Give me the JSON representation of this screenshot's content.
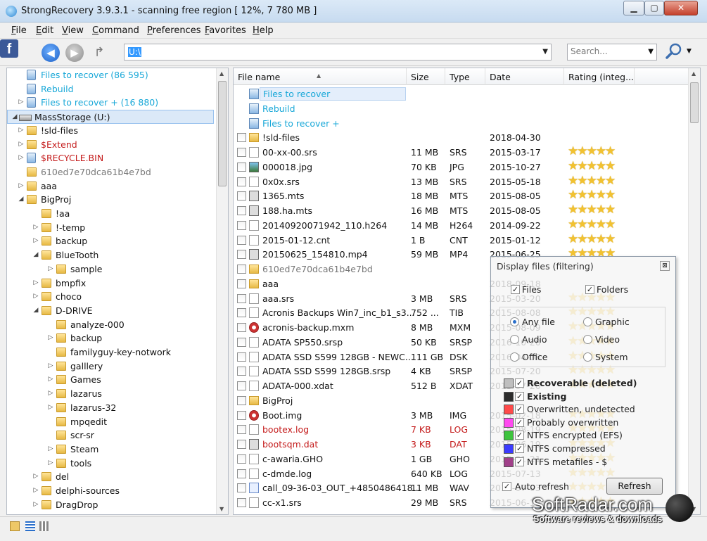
{
  "window": {
    "title": "StrongRecovery 3.9.3.1 - scanning free region [ 12%, 7 780 MB ]",
    "min": "▁",
    "max": "▢",
    "close": "✕"
  },
  "menu": [
    "File",
    "Edit",
    "View",
    "Command",
    "Preferences",
    "Favorites",
    "Help"
  ],
  "toolbar": {
    "fb": "f",
    "back": "◀",
    "forward": "▶",
    "up": "↱",
    "path": "U:\\",
    "search_placeholder": "Search...",
    "search_icon": "magnifier-icon"
  },
  "tree": [
    {
      "label": "Files to recover (86 595)",
      "level": 1,
      "icon": "bin",
      "arrow": "",
      "tone": "rec"
    },
    {
      "label": "Rebuild",
      "level": 1,
      "icon": "bin",
      "arrow": "",
      "tone": "rec"
    },
    {
      "label": "Files to recover + (16 880)",
      "level": 1,
      "icon": "bin",
      "arrow": "▷",
      "tone": "rec"
    },
    {
      "label": "MassStorage (U:)",
      "level": 0,
      "icon": "drive",
      "arrow": "◢",
      "tone": "",
      "selected": true
    },
    {
      "label": "!sld-files",
      "level": 1,
      "icon": "folder",
      "arrow": "▷",
      "tone": ""
    },
    {
      "label": "$Extend",
      "level": 1,
      "icon": "folder",
      "arrow": "▷",
      "tone": "del"
    },
    {
      "label": "$RECYCLE.BIN",
      "level": 1,
      "icon": "bin",
      "arrow": "▷",
      "tone": "del"
    },
    {
      "label": "610ed7e70dca61b4e7bd",
      "level": 1,
      "icon": "folder",
      "arrow": "",
      "tone": "gray"
    },
    {
      "label": "aaa",
      "level": 1,
      "icon": "folder",
      "arrow": "▷",
      "tone": ""
    },
    {
      "label": "BigProj",
      "level": 1,
      "icon": "folder",
      "arrow": "◢",
      "tone": ""
    },
    {
      "label": "!aa",
      "level": 2,
      "icon": "folder",
      "arrow": "",
      "tone": ""
    },
    {
      "label": "!-temp",
      "level": 2,
      "icon": "folder",
      "arrow": "▷",
      "tone": ""
    },
    {
      "label": "backup",
      "level": 2,
      "icon": "folder",
      "arrow": "▷",
      "tone": ""
    },
    {
      "label": "BlueTooth",
      "level": 2,
      "icon": "folder",
      "arrow": "◢",
      "tone": ""
    },
    {
      "label": "sample",
      "level": 3,
      "icon": "folder",
      "arrow": "▷",
      "tone": ""
    },
    {
      "label": "bmpfix",
      "level": 2,
      "icon": "folder",
      "arrow": "▷",
      "tone": ""
    },
    {
      "label": "choco",
      "level": 2,
      "icon": "folder",
      "arrow": "▷",
      "tone": ""
    },
    {
      "label": "D-DRIVE",
      "level": 2,
      "icon": "folder",
      "arrow": "◢",
      "tone": ""
    },
    {
      "label": "analyze-000",
      "level": 3,
      "icon": "folder",
      "arrow": "",
      "tone": ""
    },
    {
      "label": "backup",
      "level": 3,
      "icon": "folder",
      "arrow": "▷",
      "tone": ""
    },
    {
      "label": "familyguy-key-notwork",
      "level": 3,
      "icon": "folder",
      "arrow": "",
      "tone": ""
    },
    {
      "label": "galllery",
      "level": 3,
      "icon": "folder",
      "arrow": "▷",
      "tone": ""
    },
    {
      "label": "Games",
      "level": 3,
      "icon": "folder",
      "arrow": "▷",
      "tone": ""
    },
    {
      "label": "lazarus",
      "level": 3,
      "icon": "folder",
      "arrow": "▷",
      "tone": ""
    },
    {
      "label": "lazarus-32",
      "level": 3,
      "icon": "folder",
      "arrow": "▷",
      "tone": ""
    },
    {
      "label": "mpqedit",
      "level": 3,
      "icon": "folder",
      "arrow": "",
      "tone": ""
    },
    {
      "label": "scr-sr",
      "level": 3,
      "icon": "folder",
      "arrow": "",
      "tone": ""
    },
    {
      "label": "Steam",
      "level": 3,
      "icon": "folder",
      "arrow": "▷",
      "tone": ""
    },
    {
      "label": "tools",
      "level": 3,
      "icon": "folder",
      "arrow": "▷",
      "tone": ""
    },
    {
      "label": "del",
      "level": 2,
      "icon": "folder",
      "arrow": "▷",
      "tone": ""
    },
    {
      "label": "delphi-sources",
      "level": 2,
      "icon": "folder",
      "arrow": "▷",
      "tone": ""
    },
    {
      "label": "DragDrop",
      "level": 2,
      "icon": "folder",
      "arrow": "▷",
      "tone": ""
    }
  ],
  "columns": [
    "File name",
    "Size",
    "Type",
    "Date",
    "Rating (integ..."
  ],
  "files": [
    {
      "name": "Files to recover",
      "size": "",
      "type": "",
      "date": "",
      "icon": "bin",
      "tone": "rec",
      "cb": false,
      "stars": false,
      "hl": true
    },
    {
      "name": "Rebuild",
      "size": "",
      "type": "",
      "date": "",
      "icon": "bin",
      "tone": "rec",
      "cb": false,
      "stars": false
    },
    {
      "name": "Files to recover +",
      "size": "",
      "type": "",
      "date": "",
      "icon": "bin",
      "tone": "rec",
      "cb": false,
      "stars": false
    },
    {
      "name": "!sld-files",
      "size": "",
      "type": "",
      "date": "2018-04-30",
      "icon": "folder",
      "tone": "",
      "cb": true,
      "stars": false
    },
    {
      "name": "00-xx-00.srs",
      "size": "11 MB",
      "type": "SRS",
      "date": "2015-03-17",
      "icon": "doc",
      "tone": "",
      "cb": true,
      "stars": true
    },
    {
      "name": "000018.jpg",
      "size": "70 KB",
      "type": "JPG",
      "date": "2015-10-27",
      "icon": "img",
      "tone": "",
      "cb": true,
      "stars": true
    },
    {
      "name": "0x0x.srs",
      "size": "13 MB",
      "type": "SRS",
      "date": "2015-05-18",
      "icon": "doc",
      "tone": "",
      "cb": true,
      "stars": true
    },
    {
      "name": "1365.mts",
      "size": "18 MB",
      "type": "MTS",
      "date": "2015-08-05",
      "icon": "vid",
      "tone": "",
      "cb": true,
      "stars": true
    },
    {
      "name": "188.ha.mts",
      "size": "16 MB",
      "type": "MTS",
      "date": "2015-08-05",
      "icon": "vid",
      "tone": "",
      "cb": true,
      "stars": true
    },
    {
      "name": "20140920071942_110.h264",
      "size": "14 MB",
      "type": "H264",
      "date": "2014-09-22",
      "icon": "doc",
      "tone": "",
      "cb": true,
      "stars": true
    },
    {
      "name": "2015-01-12.cnt",
      "size": "1 B",
      "type": "CNT",
      "date": "2015-01-12",
      "icon": "doc",
      "tone": "",
      "cb": true,
      "stars": true
    },
    {
      "name": "20150625_154810.mp4",
      "size": "59 MB",
      "type": "MP4",
      "date": "2015-06-25",
      "icon": "vid",
      "tone": "",
      "cb": true,
      "stars": true
    },
    {
      "name": "610ed7e70dca61b4e7bd",
      "size": "",
      "type": "",
      "date": "",
      "icon": "folder",
      "tone": "gray",
      "cb": true,
      "stars": false
    },
    {
      "name": "aaa",
      "size": "",
      "type": "",
      "date": "2018-09-18",
      "icon": "folder",
      "tone": "",
      "cb": true,
      "stars": false
    },
    {
      "name": "aaa.srs",
      "size": "3 MB",
      "type": "SRS",
      "date": "2015-03-20",
      "icon": "doc",
      "tone": "",
      "cb": true,
      "stars": true
    },
    {
      "name": "Acronis Backups Win7_inc_b1_s3...",
      "size": "752 ...",
      "type": "TIB",
      "date": "2015-08-08",
      "icon": "doc",
      "tone": "",
      "cb": true,
      "stars": true
    },
    {
      "name": "acronis-backup.mxm",
      "size": "8 MB",
      "type": "MXM",
      "date": "2015-08-09",
      "icon": "red",
      "tone": "",
      "cb": true,
      "stars": true
    },
    {
      "name": "ADATA SP550.srsp",
      "size": "50 KB",
      "type": "SRSP",
      "date": "2016-10-20",
      "icon": "doc",
      "tone": "",
      "cb": true,
      "stars": true
    },
    {
      "name": "ADATA SSD S599 128GB - NEWC...",
      "size": "111 GB",
      "type": "DSK",
      "date": "2016-04-08",
      "icon": "doc",
      "tone": "",
      "cb": true,
      "stars": true
    },
    {
      "name": "ADATA SSD S599 128GB.srsp",
      "size": "4 KB",
      "type": "SRSP",
      "date": "2015-07-20",
      "icon": "doc",
      "tone": "",
      "cb": true,
      "stars": true
    },
    {
      "name": "ADATA-000.xdat",
      "size": "512 B",
      "type": "XDAT",
      "date": "2015-07-20",
      "icon": "doc",
      "tone": "",
      "cb": true,
      "stars": true
    },
    {
      "name": "BigProj",
      "size": "",
      "type": "",
      "date": "",
      "icon": "folder",
      "tone": "",
      "cb": true,
      "stars": false
    },
    {
      "name": "Boot.img",
      "size": "3 MB",
      "type": "IMG",
      "date": "2015-02-18",
      "icon": "red",
      "tone": "",
      "cb": true,
      "stars": true
    },
    {
      "name": "bootex.log",
      "size": "7 KB",
      "type": "LOG",
      "date": "2015-08-19",
      "icon": "doc",
      "tone": "del",
      "cb": true,
      "stars": true
    },
    {
      "name": "bootsqm.dat",
      "size": "3 KB",
      "type": "DAT",
      "date": "2015-06-19",
      "icon": "vid",
      "tone": "del",
      "cb": true,
      "stars": true
    },
    {
      "name": "c-awaria.GHO",
      "size": "1 GB",
      "type": "GHO",
      "date": "2015-01-21",
      "icon": "doc",
      "tone": "",
      "cb": true,
      "stars": true
    },
    {
      "name": "c-dmde.log",
      "size": "640 KB",
      "type": "LOG",
      "date": "2015-07-13",
      "icon": "doc",
      "tone": "",
      "cb": true,
      "stars": true
    },
    {
      "name": "call_09-36-03_OUT_+4850486418...",
      "size": "11 MB",
      "type": "WAV",
      "date": "2015-07-03",
      "icon": "audio",
      "tone": "",
      "cb": true,
      "stars": true
    },
    {
      "name": "cc-x1.srs",
      "size": "29 MB",
      "type": "SRS",
      "date": "2015-06-12",
      "icon": "doc",
      "tone": "",
      "cb": true,
      "stars": true
    }
  ],
  "filter": {
    "title": "Display files (filtering)",
    "close": "⊠",
    "files": "Files",
    "folders": "Folders",
    "types": [
      {
        "label": "Any file",
        "on": true
      },
      {
        "label": "Graphic",
        "on": false
      },
      {
        "label": "Audio",
        "on": false
      },
      {
        "label": "Video",
        "on": false
      },
      {
        "label": "Office",
        "on": false
      },
      {
        "label": "System",
        "on": false
      }
    ],
    "states": [
      {
        "label": "Recoverable (deleted)",
        "color": "#bfbfbf",
        "bold": true
      },
      {
        "label": "Existing",
        "color": "#2d2d2d",
        "bold": true
      },
      {
        "label": "Overwritten, undetected",
        "color": "#ff4a4a",
        "bold": false
      },
      {
        "label": "Probably overwritten",
        "color": "#ff4af0",
        "bold": false
      },
      {
        "label": "NTFS encrypted (EFS)",
        "color": "#3ec43e",
        "bold": false
      },
      {
        "label": "NTFS compressed",
        "color": "#3b3bff",
        "bold": false
      },
      {
        "label": "NTFS metafiles - $",
        "color": "#a1408a",
        "bold": false
      }
    ],
    "auto_refresh": "Auto refresh",
    "refresh": "Refresh"
  },
  "watermark": {
    "title": "SoftRadar.com",
    "subtitle": "Software reviews & downloads"
  }
}
